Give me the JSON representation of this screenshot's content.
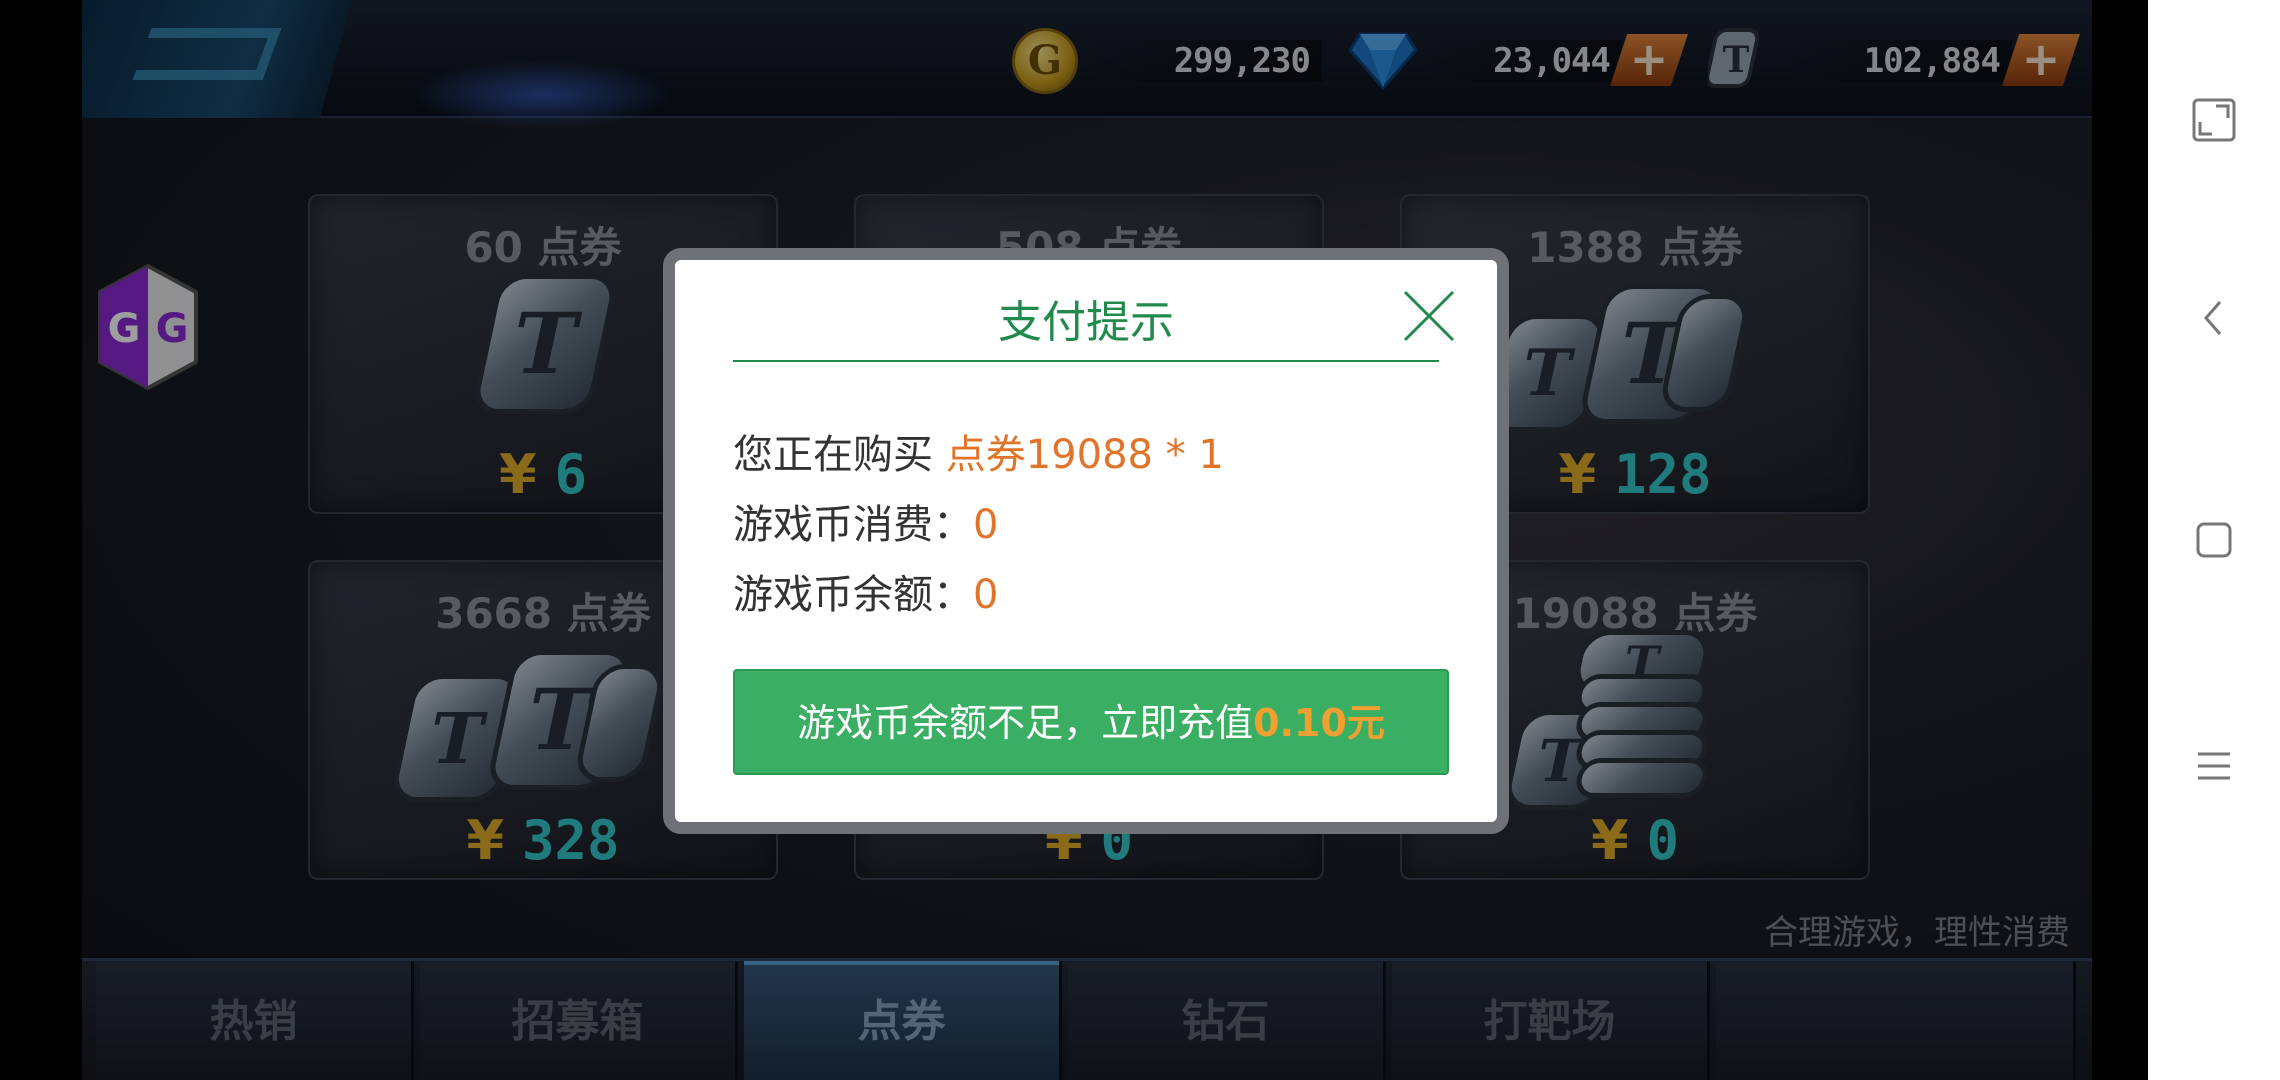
{
  "resources": {
    "gold": "299,230",
    "diamond": "23,044",
    "ticket": "102,884",
    "plus": "+"
  },
  "cards": [
    {
      "amount": "60 点券",
      "yen": "¥",
      "price": "6"
    },
    {
      "amount": "508 点券",
      "yen": "¥",
      "price": ""
    },
    {
      "amount": "1388 点券",
      "yen": "¥",
      "price": "128"
    },
    {
      "amount": "3668 点券",
      "yen": "¥",
      "price": "328"
    },
    {
      "amount": "",
      "yen": "¥",
      "price": "0"
    },
    {
      "amount": "19088 点券",
      "yen": "¥",
      "price": "0"
    }
  ],
  "coin_glyph": "T",
  "gold_glyph": "G",
  "gg_letters": [
    "G",
    "G"
  ],
  "slogan": "合理游戏，理性消费",
  "tabs": [
    "热销",
    "招募箱",
    "点券",
    "钻石",
    "打靶场"
  ],
  "active_tab": 2,
  "dialog": {
    "title": "支付提示",
    "buying_prefix": "您正在购买",
    "buying_item": "点券19088 * 1",
    "spend_label": "游戏币消费：",
    "spend_value": "0",
    "balance_label": "游戏币余额：",
    "balance_value": "0",
    "button_text": "游戏币余额不足，立即充值",
    "button_amount": "0.10元"
  },
  "colors": {
    "dialog_title": "#1f8a4c",
    "pay_button": "#3aae63",
    "highlight": "#e0742a",
    "price_number": "#33c7c8",
    "yen": "#e0ad2b"
  }
}
